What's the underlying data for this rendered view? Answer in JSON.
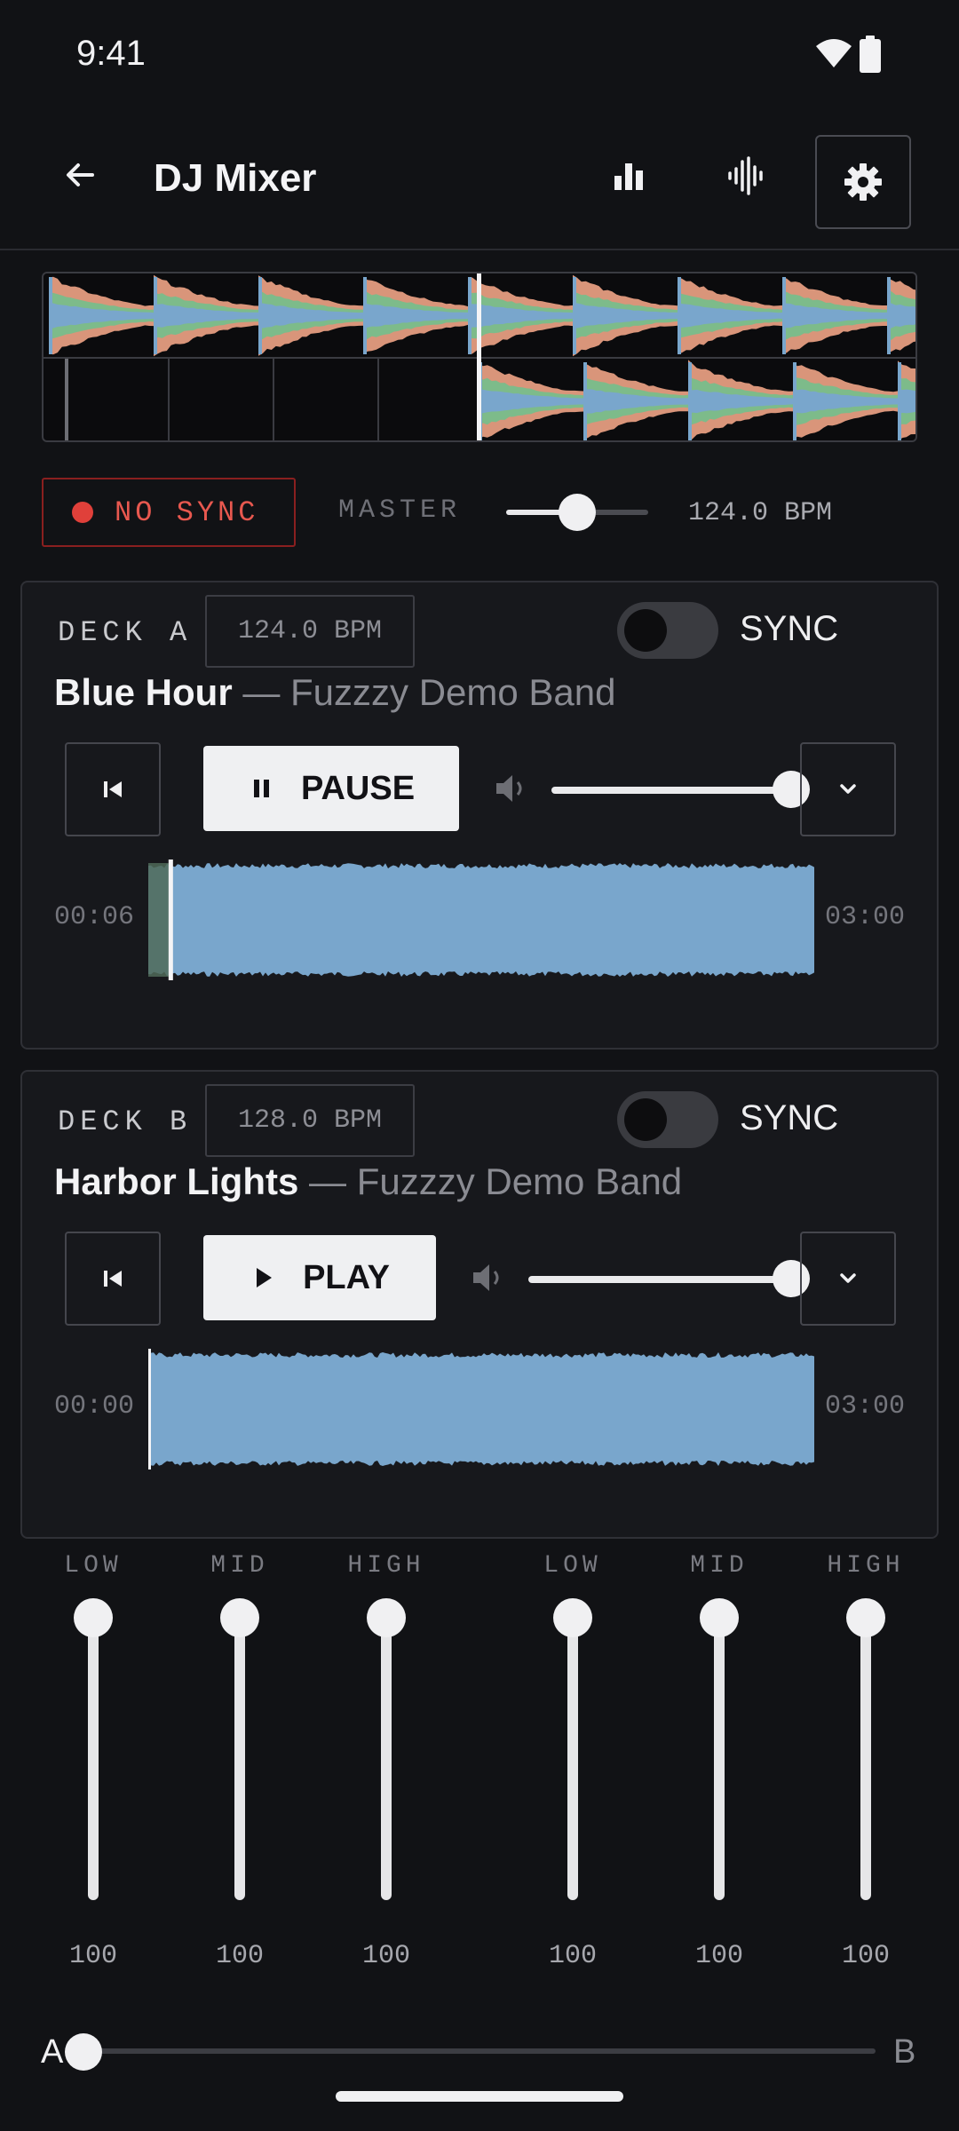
{
  "status": {
    "time": "9:41",
    "wifi_icon": "wifi-icon",
    "battery_icon": "battery-icon"
  },
  "app_bar": {
    "title": "DJ Mixer",
    "icons": [
      "back-arrow-icon",
      "bar-chart-icon",
      "waveform-icon",
      "gear-icon"
    ]
  },
  "sync_bar": {
    "no_sync_label": "NO SYNC",
    "master_label": "MASTER",
    "master_level": 0.5,
    "master_bpm": "124.0 BPM"
  },
  "decks": [
    {
      "label": "DECK A",
      "bpm": "124.0 BPM",
      "sync_label": "SYNC",
      "sync_on": false,
      "title": "Blue Hour",
      "separator": " — ",
      "artist": "Fuzzzy Demo Band",
      "play_label": "PAUSE",
      "volume": 1.0,
      "time_current": "00:06",
      "time_total": "03:00",
      "progress": 0.033
    },
    {
      "label": "DECK B",
      "bpm": "128.0 BPM",
      "sync_label": "SYNC",
      "sync_on": false,
      "title": "Harbor Lights",
      "separator": " — ",
      "artist": "Fuzzzy Demo Band",
      "play_label": "PLAY",
      "volume": 1.0,
      "time_current": "00:00",
      "time_total": "03:00",
      "progress": 0.0
    }
  ],
  "eq": {
    "deck_a": [
      {
        "label": "LOW",
        "value": "100"
      },
      {
        "label": "MID",
        "value": "100"
      },
      {
        "label": "HIGH",
        "value": "100"
      }
    ],
    "deck_b": [
      {
        "label": "LOW",
        "value": "100"
      },
      {
        "label": "MID",
        "value": "100"
      },
      {
        "label": "HIGH",
        "value": "100"
      }
    ]
  },
  "crossfader": {
    "left_label": "A",
    "right_label": "B",
    "position": 0.0
  },
  "colors": {
    "accent_red": "#e0403a",
    "wave_blue": "#79a6cc",
    "wave_green": "#7dbb8a",
    "wave_orange": "#d9957a"
  }
}
